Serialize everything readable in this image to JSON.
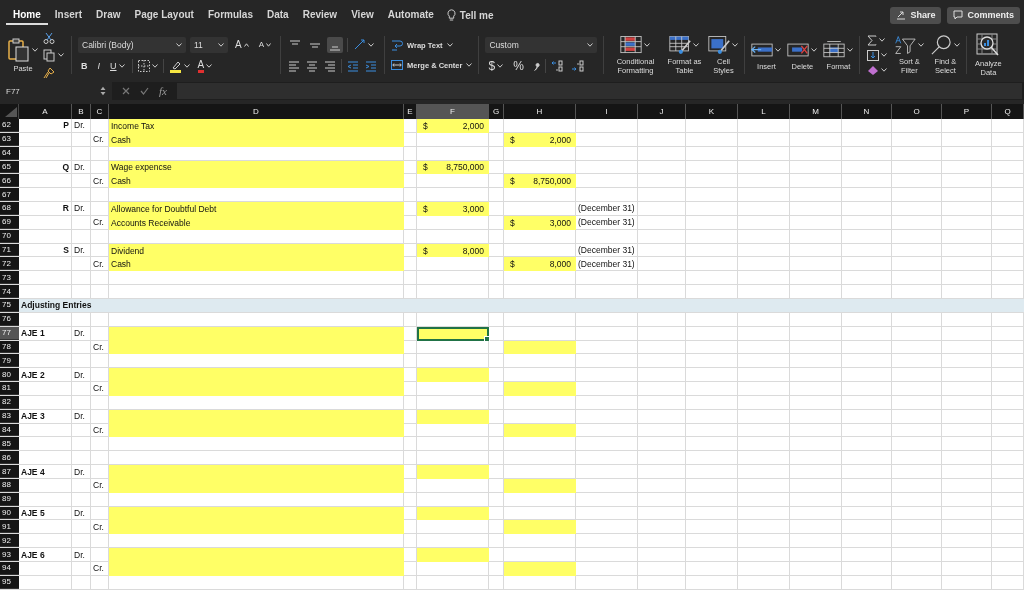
{
  "tabs": [
    {
      "label": "Home",
      "selected": true
    },
    {
      "label": "Insert",
      "selected": false
    },
    {
      "label": "Draw",
      "selected": false
    },
    {
      "label": "Page Layout",
      "selected": false
    },
    {
      "label": "Formulas",
      "selected": false
    },
    {
      "label": "Data",
      "selected": false
    },
    {
      "label": "Review",
      "selected": false
    },
    {
      "label": "View",
      "selected": false
    },
    {
      "label": "Automate",
      "selected": false
    }
  ],
  "tell_me": {
    "placeholder": "Tell me"
  },
  "share": "Share",
  "comments": "Comments",
  "ribbon": {
    "paste": "Paste",
    "font": "Calibri (Body)",
    "font_size": "11",
    "grow_font": "A",
    "shrink_font": "A",
    "bold": "B",
    "italic": "I",
    "underline": "U",
    "font_color": "A",
    "vertical_align": [
      {
        "selected": false
      },
      {
        "selected": false
      },
      {
        "selected": true
      }
    ],
    "wrap_text": "Wrap Text",
    "merge": "Merge & Center",
    "number_format": "Custom",
    "currency": "$",
    "percent": "%",
    "styles": [
      "Conditional Formatting",
      "Format as Table",
      "Cell Styles"
    ],
    "cells": [
      "Insert",
      "Delete",
      "Format"
    ],
    "sort": "Sort & Filter",
    "find": "Find & Select",
    "analyze": "Analyze Data"
  },
  "formula_bar": {
    "name_box": "F77",
    "fx": "fx"
  },
  "columns": [
    {
      "label": "A",
      "selected": false
    },
    {
      "label": "B",
      "selected": false
    },
    {
      "label": "C",
      "selected": false
    },
    {
      "label": "D",
      "selected": false
    },
    {
      "label": "E",
      "selected": false
    },
    {
      "label": "F",
      "selected": true
    },
    {
      "label": "G",
      "selected": false
    },
    {
      "label": "H",
      "selected": false
    },
    {
      "label": "I",
      "selected": false
    },
    {
      "label": "J",
      "selected": false
    },
    {
      "label": "K",
      "selected": false
    },
    {
      "label": "L",
      "selected": false
    },
    {
      "label": "M",
      "selected": false
    },
    {
      "label": "N",
      "selected": false
    },
    {
      "label": "O",
      "selected": false
    },
    {
      "label": "P",
      "selected": false
    },
    {
      "label": "Q",
      "selected": false
    }
  ],
  "rows": [
    {
      "number": "62",
      "kind": "entry",
      "selected": false,
      "entry": "P",
      "debit_side": "Dr.",
      "account": {
        "text": "Income Tax",
        "highlighted": true,
        "selected": false
      },
      "debit": {
        "symbol": "$",
        "amount": "2,000",
        "highlighted": true,
        "selected": false
      }
    },
    {
      "number": "63",
      "kind": "entry",
      "selected": false,
      "credit_side": "Cr.",
      "account": {
        "text": "Cash",
        "highlighted": true,
        "selected": false
      },
      "credit": {
        "symbol": "$",
        "amount": "2,000",
        "highlighted": true,
        "selected": false
      }
    },
    {
      "number": "64",
      "kind": "entry",
      "selected": false
    },
    {
      "number": "65",
      "kind": "entry",
      "selected": false,
      "entry": "Q",
      "debit_side": "Dr.",
      "account": {
        "text": "Wage expencse",
        "highlighted": true,
        "selected": false
      },
      "debit": {
        "symbol": "$",
        "amount": "8,750,000",
        "highlighted": true,
        "selected": false
      }
    },
    {
      "number": "66",
      "kind": "entry",
      "selected": false,
      "credit_side": "Cr.",
      "account": {
        "text": "Cash",
        "highlighted": true,
        "selected": false
      },
      "credit": {
        "symbol": "$",
        "amount": "8,750,000",
        "highlighted": true,
        "selected": false
      }
    },
    {
      "number": "67",
      "kind": "entry",
      "selected": false
    },
    {
      "number": "68",
      "kind": "entry",
      "selected": false,
      "entry": "R",
      "debit_side": "Dr.",
      "account": {
        "text": "Allowance for Doubtful Debt",
        "highlighted": true,
        "selected": false
      },
      "debit": {
        "symbol": "$",
        "amount": "3,000",
        "highlighted": true,
        "selected": false
      },
      "note": "(December 31)"
    },
    {
      "number": "69",
      "kind": "entry",
      "selected": false,
      "credit_side": "Cr.",
      "account": {
        "text": "Accounts Receivable",
        "highlighted": true,
        "selected": false
      },
      "credit": {
        "symbol": "$",
        "amount": "3,000",
        "highlighted": true,
        "selected": false
      },
      "note": "(December 31)"
    },
    {
      "number": "70",
      "kind": "entry",
      "selected": false
    },
    {
      "number": "71",
      "kind": "entry",
      "selected": false,
      "entry": "S",
      "debit_side": "Dr.",
      "account": {
        "text": "Dividend",
        "highlighted": true,
        "selected": false
      },
      "debit": {
        "symbol": "$",
        "amount": "8,000",
        "highlighted": true,
        "selected": false
      },
      "note": "(December 31)"
    },
    {
      "number": "72",
      "kind": "entry",
      "selected": false,
      "credit_side": "Cr.",
      "account": {
        "text": "Cash",
        "highlighted": true,
        "selected": false
      },
      "credit": {
        "symbol": "$",
        "amount": "8,000",
        "highlighted": true,
        "selected": false
      },
      "note": "(December 31)"
    },
    {
      "number": "73",
      "kind": "entry",
      "selected": false
    },
    {
      "number": "74",
      "kind": "entry",
      "selected": false
    },
    {
      "number": "75",
      "kind": "section",
      "selected": false,
      "title": "Adjusting Entries"
    },
    {
      "number": "76",
      "kind": "entry",
      "selected": false
    },
    {
      "number": "77",
      "kind": "entry",
      "selected": true,
      "title": "AJE 1",
      "debit_side": "Dr.",
      "account": {
        "highlighted": true,
        "selected": false
      },
      "debit": {
        "highlighted": true,
        "selected": true
      }
    },
    {
      "number": "78",
      "kind": "entry",
      "selected": false,
      "credit_side": "Cr.",
      "account": {
        "highlighted": true,
        "selected": false
      },
      "credit": {
        "highlighted": true,
        "selected": false
      }
    },
    {
      "number": "79",
      "kind": "entry",
      "selected": false
    },
    {
      "number": "80",
      "kind": "entry",
      "selected": false,
      "title": "AJE 2",
      "debit_side": "Dr.",
      "account": {
        "highlighted": true,
        "selected": false
      },
      "debit": {
        "highlighted": true,
        "selected": false
      }
    },
    {
      "number": "81",
      "kind": "entry",
      "selected": false,
      "credit_side": "Cr.",
      "account": {
        "highlighted": true,
        "selected": false
      },
      "credit": {
        "highlighted": true,
        "selected": false
      }
    },
    {
      "number": "82",
      "kind": "entry",
      "selected": false
    },
    {
      "number": "83",
      "kind": "entry",
      "selected": false,
      "title": "AJE 3",
      "debit_side": "Dr.",
      "account": {
        "highlighted": true,
        "selected": false
      },
      "debit": {
        "highlighted": true,
        "selected": false
      }
    },
    {
      "number": "84",
      "kind": "entry",
      "selected": false,
      "credit_side": "Cr.",
      "account": {
        "highlighted": true,
        "selected": false
      },
      "credit": {
        "highlighted": true,
        "selected": false
      }
    },
    {
      "number": "85",
      "kind": "entry",
      "selected": false
    },
    {
      "number": "86",
      "kind": "entry",
      "selected": false
    },
    {
      "number": "87",
      "kind": "entry",
      "selected": false,
      "title": "AJE 4",
      "debit_side": "Dr.",
      "account": {
        "highlighted": true,
        "selected": false
      },
      "debit": {
        "highlighted": true,
        "selected": false
      }
    },
    {
      "number": "88",
      "kind": "entry",
      "selected": false,
      "credit_side": "Cr.",
      "account": {
        "highlighted": true,
        "selected": false
      },
      "credit": {
        "highlighted": true,
        "selected": false
      }
    },
    {
      "number": "89",
      "kind": "entry",
      "selected": false
    },
    {
      "number": "90",
      "kind": "entry",
      "selected": false,
      "title": "AJE 5",
      "debit_side": "Dr.",
      "account": {
        "highlighted": true,
        "selected": false
      },
      "debit": {
        "highlighted": true,
        "selected": false
      }
    },
    {
      "number": "91",
      "kind": "entry",
      "selected": false,
      "credit_side": "Cr.",
      "account": {
        "highlighted": true,
        "selected": false
      },
      "credit": {
        "highlighted": true,
        "selected": false
      }
    },
    {
      "number": "92",
      "kind": "entry",
      "selected": false
    },
    {
      "number": "93",
      "kind": "entry",
      "selected": false,
      "title": "AJE 6",
      "debit_side": "Dr.",
      "account": {
        "highlighted": true,
        "selected": false
      },
      "debit": {
        "highlighted": true,
        "selected": false
      }
    },
    {
      "number": "94",
      "kind": "entry",
      "selected": false,
      "credit_side": "Cr.",
      "account": {
        "highlighted": true,
        "selected": false
      },
      "credit": {
        "highlighted": true,
        "selected": false
      }
    },
    {
      "number": "95",
      "kind": "entry",
      "selected": false
    }
  ]
}
